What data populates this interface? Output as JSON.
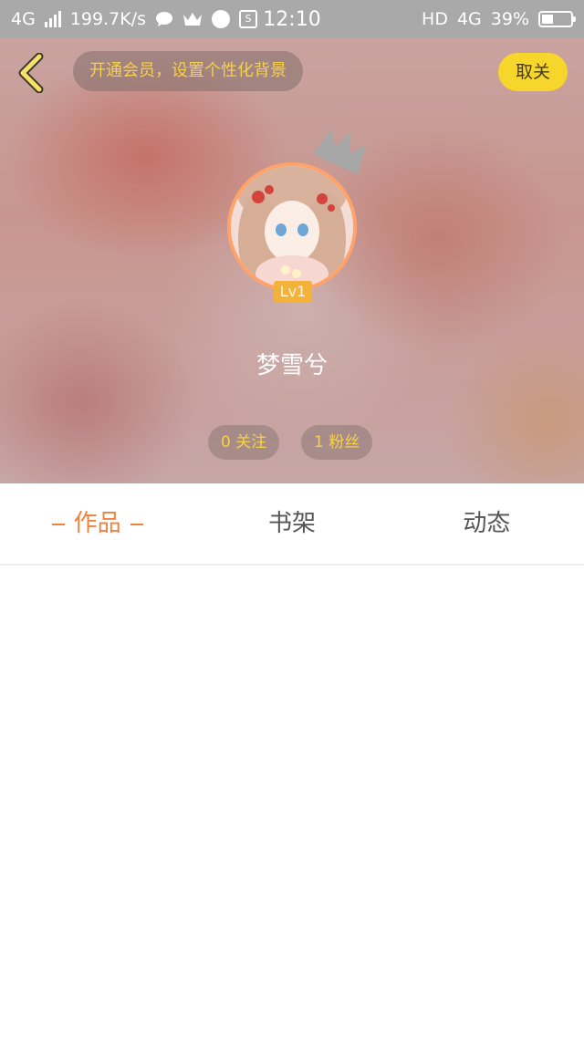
{
  "status_bar": {
    "network": "4G",
    "speed": "199.7K/s",
    "time": "12:10",
    "hd": "HD",
    "network_right": "4G",
    "battery": "39%",
    "battery_level": 0.39
  },
  "header": {
    "vip_prompt": "开通会员，设置个性化背景",
    "unfollow_label": "取关"
  },
  "profile": {
    "level": "Lv1",
    "username": "梦雪兮",
    "following": "0 关注",
    "fans": "1 粉丝"
  },
  "tabs": [
    {
      "label": "作品",
      "active": true
    },
    {
      "label": "书架",
      "active": false
    },
    {
      "label": "动态",
      "active": false
    }
  ],
  "colors": {
    "accent": "#f0823e",
    "yellow": "#f6d62a",
    "status_bar": "#a9a9a9"
  }
}
